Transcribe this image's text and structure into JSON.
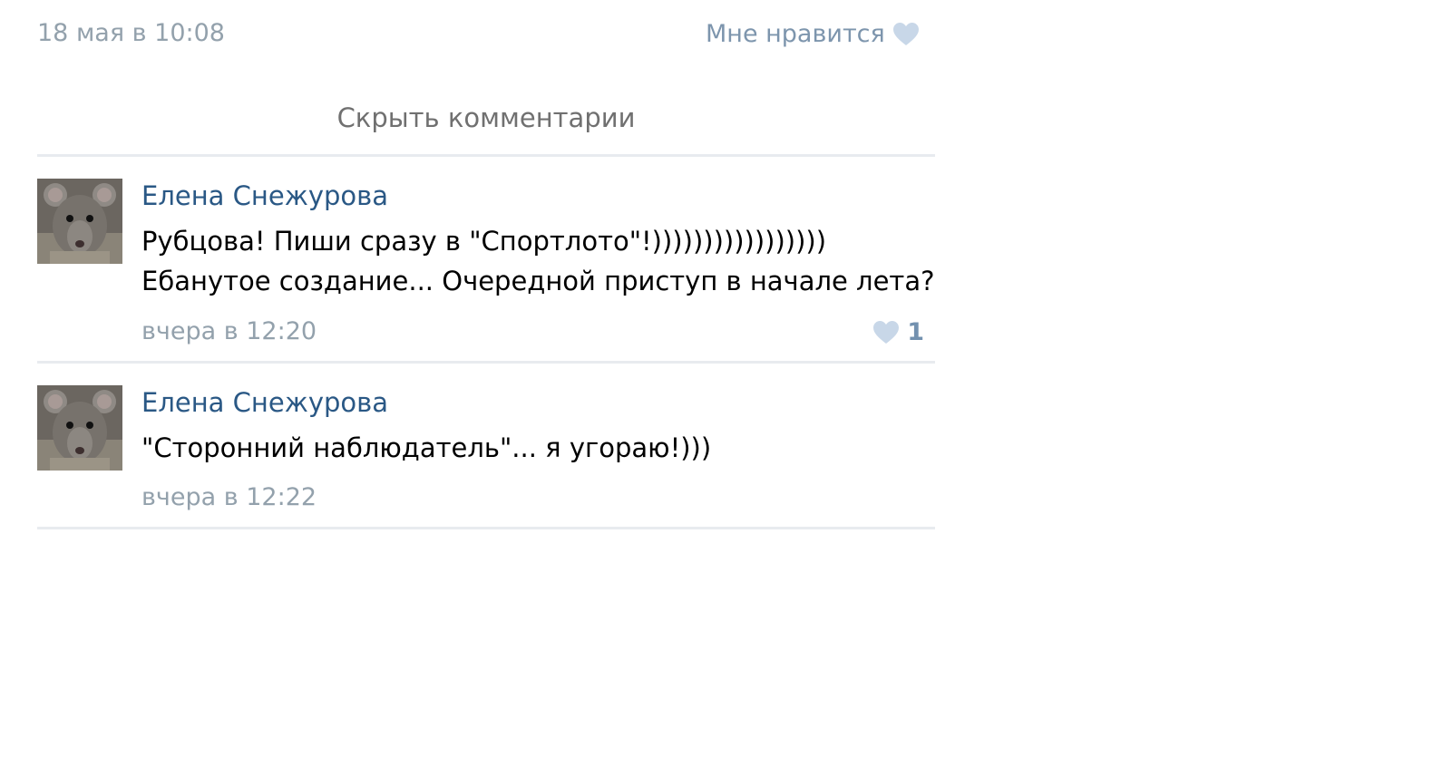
{
  "post": {
    "date": "18 мая в 10:08",
    "like_label": "Мне нравится",
    "hide_comments_label": "Скрыть комментарии"
  },
  "comments": [
    {
      "author": "Елена Снежурова",
      "lines": [
        "Рубцова! Пиши сразу в \"Спортлото\"!)))))))))))))))))",
        "Ебанутое создание... Очередной приступ в начале лета?"
      ],
      "time": "вчера в 12:20",
      "likes": "1"
    },
    {
      "author": "Елена Снежурова",
      "lines": [
        "\"Сторонний наблюдатель\"... я угораю!)))"
      ],
      "time": "вчера в 12:22"
    }
  ],
  "colors": {
    "link": "#2a5885",
    "meta": "#93a1ac",
    "like_accent": "#7391af",
    "heart": "#c8d7e8",
    "divider": "#e8ebef"
  },
  "icons": {
    "like": "heart-icon",
    "avatar": "rat-avatar"
  }
}
